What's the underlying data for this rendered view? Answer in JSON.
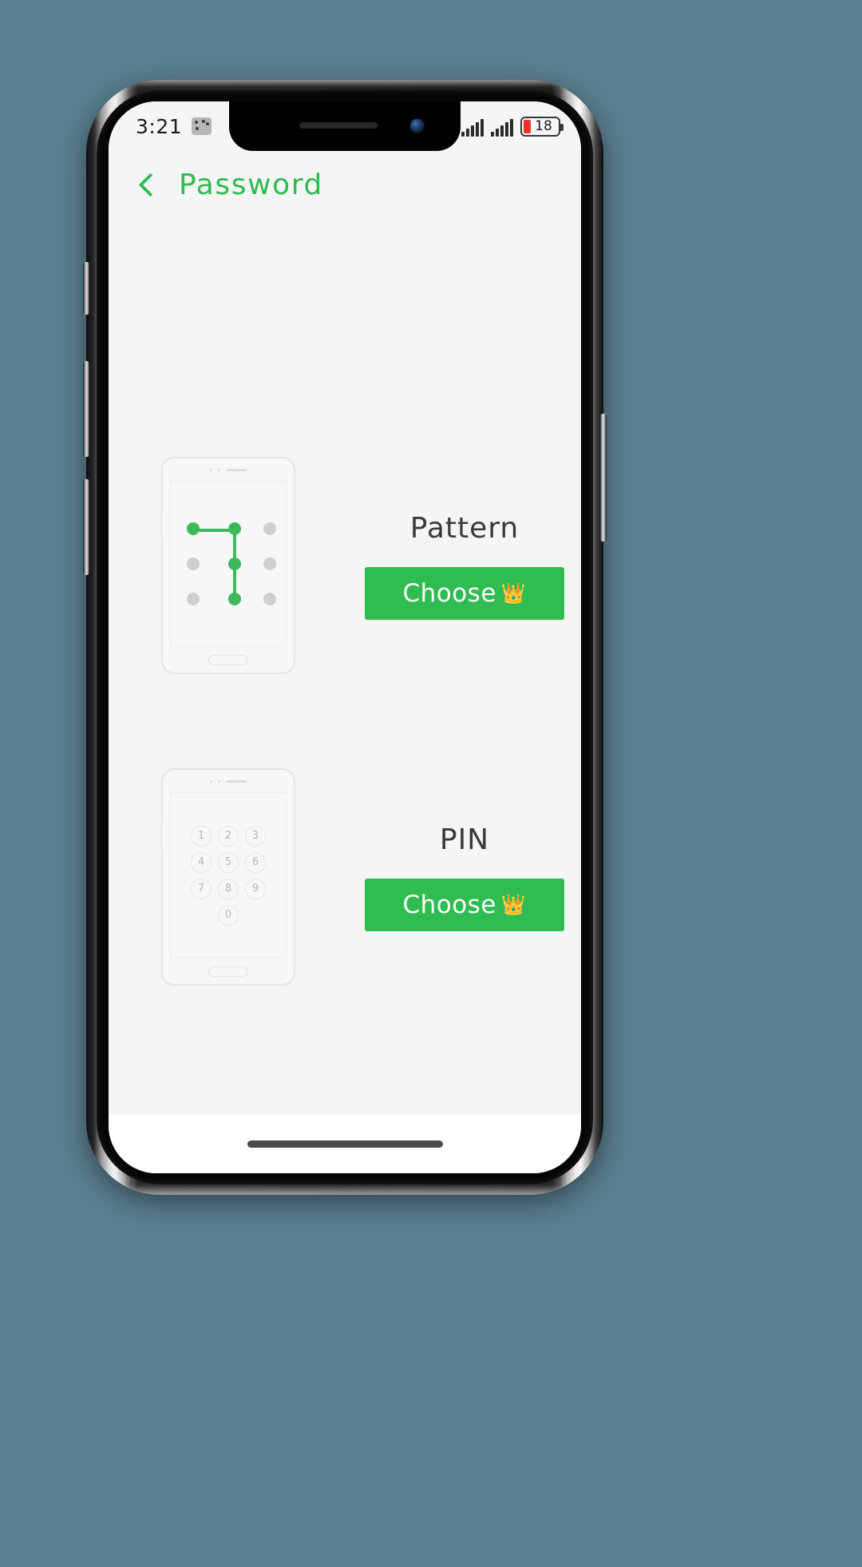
{
  "statusbar": {
    "time": "3:21",
    "app_badge_icon": "app-badge-icon",
    "signal_primary_icon": "signal-bars-icon",
    "signal_secondary_icon": "signal-bars-icon",
    "battery_icon": "battery-icon",
    "battery_percent": "18"
  },
  "appbar": {
    "back_icon": "back-chevron-icon",
    "title": "Password",
    "title_color": "#2fbc50"
  },
  "theme": {
    "accent": "#2fbc50",
    "button_green": "#2fbc50",
    "screen_bg": "#f5f5f5",
    "label_color": "#3a3a3a",
    "dot_inactive": "#cfcfcf",
    "dot_active": "#3cba5a",
    "battery_low": "#e8342c"
  },
  "options": [
    {
      "id": "pattern",
      "label": "Pattern",
      "button_label": "Choose",
      "button_badge": "👑",
      "illustration": "pattern-lock-illustration",
      "pattern": {
        "active_dots": [
          0,
          1,
          4,
          7
        ],
        "inactive_dots": [
          2,
          3,
          5,
          6,
          8
        ],
        "path": [
          0,
          1,
          4,
          7
        ]
      }
    },
    {
      "id": "pin",
      "label": "PIN",
      "button_label": "Choose",
      "button_badge": "👑",
      "illustration": "pin-keypad-illustration",
      "keys": [
        "1",
        "2",
        "3",
        "4",
        "5",
        "6",
        "7",
        "8",
        "9",
        "0"
      ]
    }
  ],
  "home_indicator": "home-indicator-bar"
}
